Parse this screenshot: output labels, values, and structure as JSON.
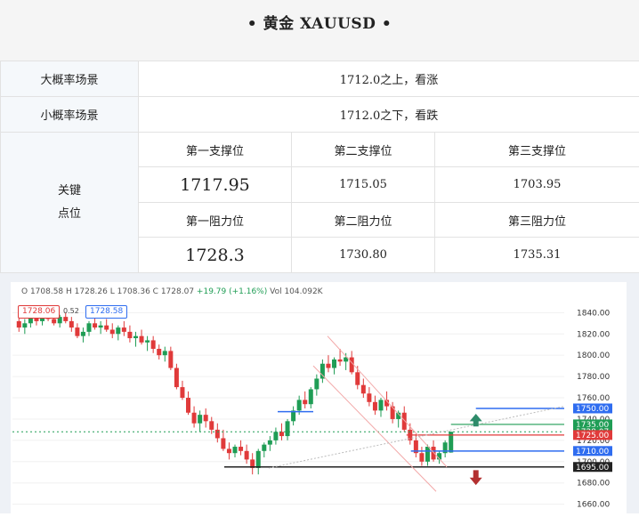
{
  "header": {
    "title": "• 黄金 XAUUSD •"
  },
  "scenarios": [
    {
      "label": "大概率场景",
      "text": "1712.0之上，看涨"
    },
    {
      "label": "小概率场景",
      "text": "1712.0之下，看跌"
    }
  ],
  "key_levels": {
    "label_line1": "关键",
    "label_line2": "点位",
    "support_headers": [
      "第一支撑位",
      "第二支撑位",
      "第三支撑位"
    ],
    "support_values": [
      "1717.95",
      "1715.05",
      "1703.95"
    ],
    "resistance_headers": [
      "第一阻力位",
      "第二阻力位",
      "第三阻力位"
    ],
    "resistance_values": [
      "1728.3",
      "1730.80",
      "1735.31"
    ]
  },
  "chart": {
    "legend_prefix": "O 1708.58 H 1728.26 L 1708.36 C 1728.07",
    "legend_change": "+19.79 (+1.16%)",
    "legend_vol": "Vol 104.092K",
    "sell_price": "1728.06",
    "spread": "0.52",
    "buy_price": "1728.58",
    "colors": {
      "up": "#1f9d55",
      "down": "#e03a3a",
      "blue": "#2f6df0",
      "dark": "#222222"
    }
  },
  "chart_data": {
    "type": "candlestick",
    "y_ticks": [
      1840,
      1820,
      1800,
      1780,
      1760,
      1740,
      1720,
      1700,
      1680,
      1660
    ],
    "ylim": [
      1658,
      1852
    ],
    "price_labels": [
      {
        "value": 1750,
        "text": "1750.00",
        "color": "#2f6df0"
      },
      {
        "value": 1735,
        "text": "1735.00",
        "color": "#1f9d55"
      },
      {
        "value": 1728.07,
        "text": "1728.07",
        "color": "#1f9d55"
      },
      {
        "value": 1725,
        "text": "1725.00",
        "color": "#e03a3a"
      },
      {
        "value": 1710,
        "text": "1710.00",
        "color": "#2f6df0"
      },
      {
        "value": 1695,
        "text": "1695.00",
        "color": "#222222"
      }
    ],
    "candles": [
      [
        1832,
        1838,
        1822,
        1826
      ],
      [
        1826,
        1834,
        1820,
        1830
      ],
      [
        1830,
        1842,
        1826,
        1836
      ],
      [
        1836,
        1840,
        1828,
        1832
      ],
      [
        1832,
        1840,
        1828,
        1838
      ],
      [
        1838,
        1844,
        1832,
        1834
      ],
      [
        1834,
        1838,
        1828,
        1830
      ],
      [
        1830,
        1838,
        1826,
        1836
      ],
      [
        1836,
        1840,
        1830,
        1832
      ],
      [
        1832,
        1836,
        1822,
        1826
      ],
      [
        1826,
        1830,
        1816,
        1818
      ],
      [
        1818,
        1826,
        1812,
        1822
      ],
      [
        1822,
        1832,
        1818,
        1830
      ],
      [
        1830,
        1836,
        1824,
        1826
      ],
      [
        1826,
        1832,
        1820,
        1828
      ],
      [
        1828,
        1834,
        1822,
        1824
      ],
      [
        1824,
        1830,
        1816,
        1820
      ],
      [
        1820,
        1828,
        1814,
        1826
      ],
      [
        1826,
        1832,
        1818,
        1822
      ],
      [
        1822,
        1828,
        1812,
        1816
      ],
      [
        1816,
        1822,
        1808,
        1818
      ],
      [
        1818,
        1824,
        1810,
        1812
      ],
      [
        1812,
        1818,
        1804,
        1814
      ],
      [
        1814,
        1818,
        1802,
        1806
      ],
      [
        1806,
        1810,
        1796,
        1800
      ],
      [
        1800,
        1808,
        1794,
        1804
      ],
      [
        1804,
        1808,
        1786,
        1788
      ],
      [
        1788,
        1792,
        1768,
        1770
      ],
      [
        1770,
        1776,
        1758,
        1760
      ],
      [
        1760,
        1766,
        1744,
        1746
      ],
      [
        1746,
        1752,
        1732,
        1736
      ],
      [
        1736,
        1748,
        1728,
        1744
      ],
      [
        1744,
        1750,
        1732,
        1738
      ],
      [
        1738,
        1742,
        1726,
        1730
      ],
      [
        1730,
        1736,
        1718,
        1722
      ],
      [
        1722,
        1730,
        1710,
        1712
      ],
      [
        1712,
        1718,
        1702,
        1708
      ],
      [
        1708,
        1716,
        1704,
        1714
      ],
      [
        1714,
        1720,
        1706,
        1710
      ],
      [
        1710,
        1716,
        1698,
        1702
      ],
      [
        1702,
        1708,
        1688,
        1694
      ],
      [
        1694,
        1712,
        1688,
        1710
      ],
      [
        1710,
        1718,
        1704,
        1716
      ],
      [
        1716,
        1724,
        1710,
        1720
      ],
      [
        1720,
        1732,
        1716,
        1728
      ],
      [
        1728,
        1736,
        1720,
        1724
      ],
      [
        1724,
        1740,
        1720,
        1738
      ],
      [
        1738,
        1752,
        1734,
        1748
      ],
      [
        1748,
        1762,
        1744,
        1758
      ],
      [
        1758,
        1766,
        1750,
        1754
      ],
      [
        1754,
        1770,
        1750,
        1768
      ],
      [
        1768,
        1782,
        1762,
        1778
      ],
      [
        1778,
        1796,
        1774,
        1792
      ],
      [
        1792,
        1800,
        1784,
        1788
      ],
      [
        1788,
        1798,
        1782,
        1796
      ],
      [
        1796,
        1806,
        1790,
        1794
      ],
      [
        1794,
        1802,
        1786,
        1798
      ],
      [
        1798,
        1804,
        1782,
        1784
      ],
      [
        1784,
        1790,
        1768,
        1772
      ],
      [
        1772,
        1778,
        1760,
        1764
      ],
      [
        1764,
        1770,
        1752,
        1756
      ],
      [
        1756,
        1762,
        1744,
        1748
      ],
      [
        1748,
        1760,
        1742,
        1758
      ],
      [
        1758,
        1766,
        1748,
        1752
      ],
      [
        1752,
        1756,
        1736,
        1740
      ],
      [
        1740,
        1748,
        1732,
        1746
      ],
      [
        1746,
        1752,
        1728,
        1730
      ],
      [
        1730,
        1736,
        1716,
        1720
      ],
      [
        1720,
        1726,
        1704,
        1708
      ],
      [
        1708,
        1714,
        1696,
        1700
      ],
      [
        1700,
        1716,
        1696,
        1714
      ],
      [
        1714,
        1720,
        1700,
        1702
      ],
      [
        1702,
        1710,
        1698,
        1708
      ],
      [
        1708,
        1720,
        1704,
        1718
      ],
      [
        1708.58,
        1728.26,
        1708.36,
        1728.07
      ]
    ]
  }
}
